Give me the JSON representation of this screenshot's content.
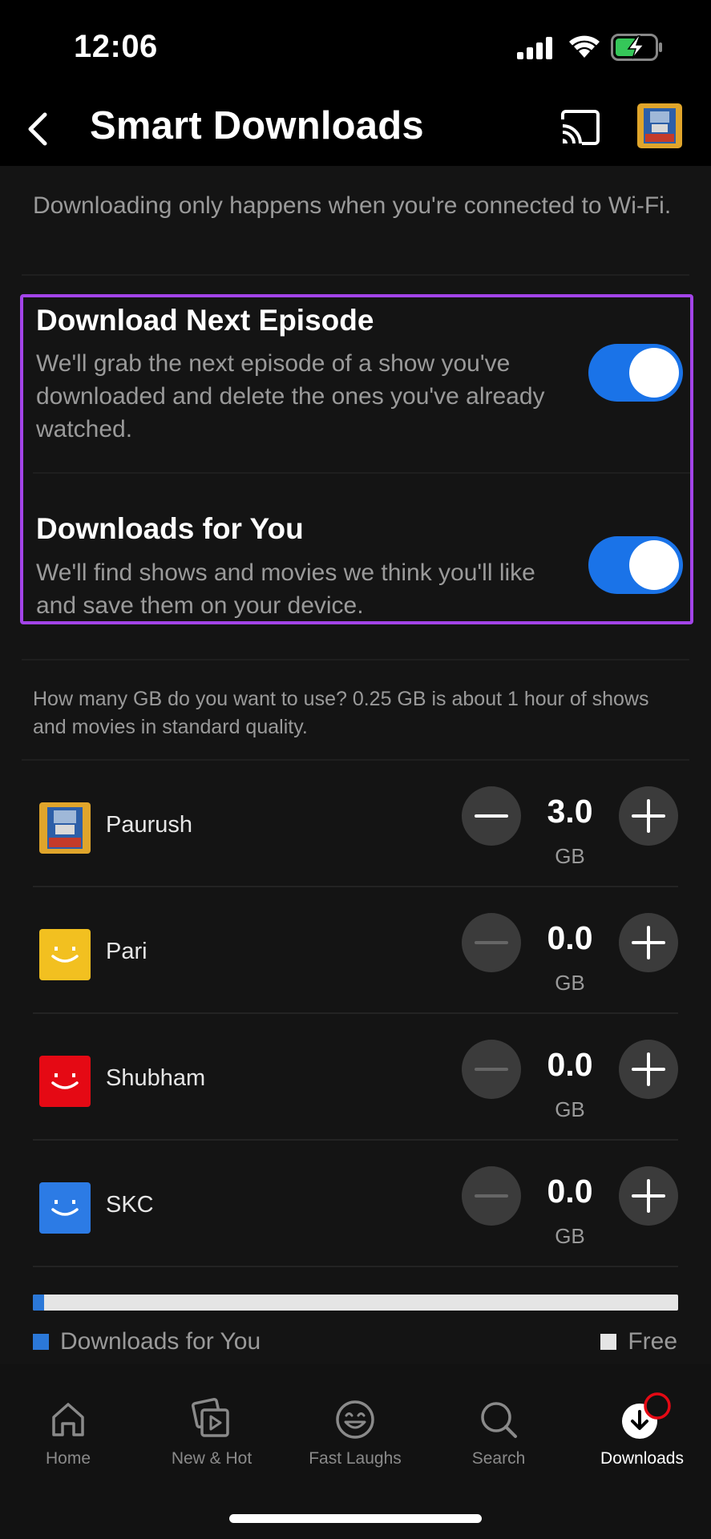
{
  "status_bar": {
    "time": "12:06",
    "icons": [
      "signal-icon",
      "wifi-icon",
      "battery-charging-icon"
    ]
  },
  "header": {
    "title": "Smart Downloads",
    "back_icon": "back-chevron-icon",
    "cast_icon": "cast-icon",
    "avatar": "profile-avatar-robot"
  },
  "wifi_note": "Downloading only happens when you're connected to Wi-Fi.",
  "settings": [
    {
      "title": "Download Next Episode",
      "description": "We'll grab the next episode of a show you've downloaded and delete the ones you've already watched.",
      "enabled": true
    },
    {
      "title": "Downloads for You",
      "description": "We'll find shows and movies we think you'll like and save them on your device.",
      "enabled": true
    }
  ],
  "gb_note": "How many GB do you want to use? 0.25 GB is about 1 hour of shows and movies in standard quality.",
  "profiles": [
    {
      "name": "Paurush",
      "value": "3.0",
      "unit": "GB",
      "avatar_color": "#d9a21b",
      "minus_enabled": true
    },
    {
      "name": "Pari",
      "value": "0.0",
      "unit": "GB",
      "avatar_color": "#f2c020",
      "minus_enabled": false
    },
    {
      "name": "Shubham",
      "value": "0.0",
      "unit": "GB",
      "avatar_color": "#e50914",
      "minus_enabled": false
    },
    {
      "name": "SKC",
      "value": "0.0",
      "unit": "GB",
      "avatar_color": "#2c7be5",
      "minus_enabled": false
    }
  ],
  "storage": {
    "downloads_for_you_fraction": 0.018,
    "legend_downloads_label": "Downloads for You",
    "legend_free_label": "Free",
    "downloads_color": "#2b78d8",
    "free_color": "#e5e5e5"
  },
  "bottom_nav": [
    {
      "label": "Home",
      "icon": "home-icon",
      "active": false
    },
    {
      "label": "New & Hot",
      "icon": "play-stack-icon",
      "active": false
    },
    {
      "label": "Fast Laughs",
      "icon": "smiley-icon",
      "active": false
    },
    {
      "label": "Search",
      "icon": "search-icon",
      "active": false
    },
    {
      "label": "Downloads",
      "icon": "download-icon",
      "active": true
    }
  ],
  "colors": {
    "highlight": "#a344e8",
    "toggle_on": "#1a73e8",
    "background": "#141414"
  }
}
